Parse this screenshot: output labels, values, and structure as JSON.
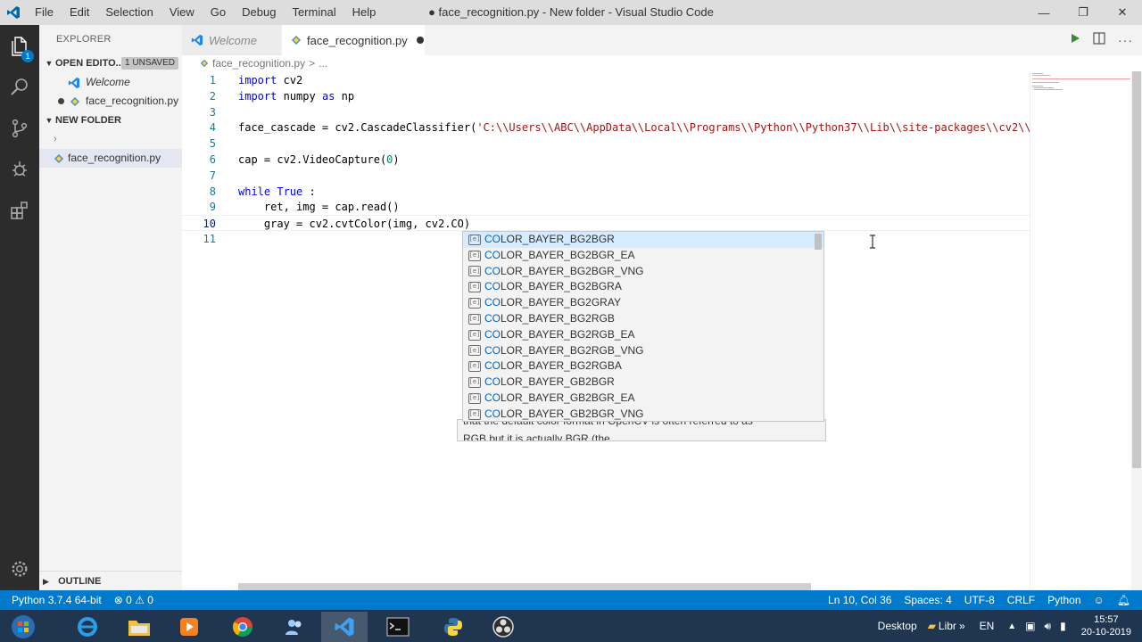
{
  "window": {
    "title": "● face_recognition.py - New folder - Visual Studio Code",
    "menu": [
      "File",
      "Edit",
      "Selection",
      "View",
      "Go",
      "Debug",
      "Terminal",
      "Help"
    ],
    "controls": {
      "minimize": "—",
      "restore": "❐",
      "close": "✕"
    }
  },
  "activity_bar": {
    "badge": "1",
    "icons": [
      "files-icon",
      "search-icon",
      "source-control-icon",
      "debug-icon",
      "extensions-icon",
      "settings-gear-icon"
    ]
  },
  "sidebar": {
    "title": "EXPLORER",
    "open_editors": {
      "label": "OPEN EDITO...",
      "badge": "1 UNSAVED",
      "items": [
        {
          "label": "Welcome"
        },
        {
          "label": "face_recognition.py"
        }
      ]
    },
    "folder": {
      "label": "NEW FOLDER",
      "items": [
        {
          "label": ""
        },
        {
          "label": "face_recognition.py"
        }
      ]
    },
    "outline": "OUTLINE"
  },
  "tabs": [
    {
      "label": "Welcome"
    },
    {
      "label": "face_recognition.py"
    }
  ],
  "breadcrumb": {
    "file": "face_recognition.py",
    "sep": ">",
    "rest": "..."
  },
  "editor": {
    "lines": [
      {
        "n": "1",
        "tokens": [
          [
            "kw",
            "import"
          ],
          [
            "",
            "cv2"
          ]
        ]
      },
      {
        "n": "2",
        "tokens": [
          [
            "kw",
            "import"
          ],
          [
            "",
            "numpy "
          ],
          [
            "kw",
            "as"
          ],
          [
            "",
            " np"
          ]
        ]
      },
      {
        "n": "3",
        "tokens": []
      },
      {
        "n": "4",
        "tokens": [
          [
            "",
            "face_cascade = cv2.CascadeClassifier("
          ],
          [
            "str",
            "'C:\\\\Users\\\\ABC\\\\AppData\\\\Local\\\\Programs\\\\Python\\\\Python37\\\\Lib\\\\site-packages\\\\cv2\\\\"
          ]
        ]
      },
      {
        "n": "5",
        "tokens": []
      },
      {
        "n": "6",
        "tokens": [
          [
            "",
            "cap = cv2.VideoCapture("
          ],
          [
            "numlit",
            "0"
          ],
          [
            "",
            ")"
          ]
        ]
      },
      {
        "n": "7",
        "tokens": []
      },
      {
        "n": "8",
        "tokens": [
          [
            "kw",
            "while"
          ],
          [
            "",
            ""
          ],
          [
            "kw",
            "True"
          ],
          [
            "",
            ":"
          ]
        ]
      },
      {
        "n": "9",
        "tokens": [
          [
            "",
            "    ret, img = cap.read()"
          ]
        ]
      },
      {
        "n": "10",
        "tokens": [
          [
            "",
            "    gray = cv2.cvtColor(img, cv2.CO)"
          ]
        ]
      },
      {
        "n": "11",
        "tokens": []
      }
    ]
  },
  "suggestions": {
    "typed": "CO",
    "items": [
      "COLOR_BAYER_BG2BGR",
      "COLOR_BAYER_BG2BGR_EA",
      "COLOR_BAYER_BG2BGR_VNG",
      "COLOR_BAYER_BG2BGRA",
      "COLOR_BAYER_BG2GRAY",
      "COLOR_BAYER_BG2RGB",
      "COLOR_BAYER_BG2RGB_EA",
      "COLOR_BAYER_BG2RGB_VNG",
      "COLOR_BAYER_BG2RGBA",
      "COLOR_BAYER_GB2BGR",
      "COLOR_BAYER_GB2BGR_EA",
      "COLOR_BAYER_GB2BGR_VNG"
    ],
    "doc_line1": "that the default color format in OpenCV is often referred to as",
    "doc_line2": "RGB but it is actually BGR (the"
  },
  "statusbar": {
    "python": "Python 3.7.4 64-bit",
    "problems": "⊗ 0 ⚠ 0",
    "position": "Ln 10, Col 36",
    "spaces": "Spaces: 4",
    "encoding": "UTF-8",
    "eol": "CRLF",
    "language": "Python"
  },
  "taskbar": {
    "desktop": "Desktop",
    "libraries": "Libr",
    "lang": "EN",
    "time": "15:57",
    "date": "20-10-2019"
  },
  "colors": {
    "accent": "#007acc",
    "keyword": "#0000ff",
    "string": "#a31515",
    "number": "#09885a",
    "line_number": "#237893"
  }
}
